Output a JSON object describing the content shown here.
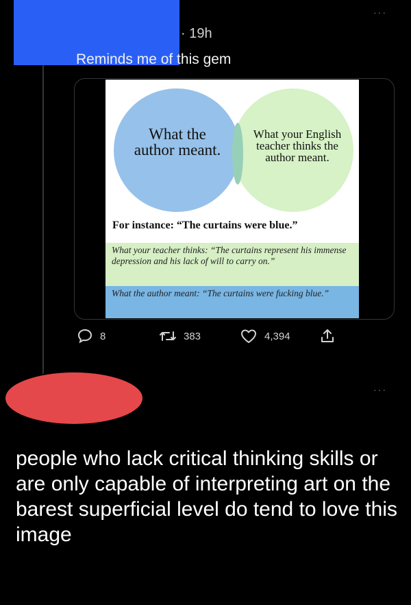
{
  "tweet": {
    "time": "· 19h",
    "text": "Reminds me of this gem",
    "more_label": "···",
    "image": {
      "left_circle": "What the author meant.",
      "right_circle": "What your English teacher thinks the author meant.",
      "instance": "For instance: “The curtains were blue.”",
      "teacher_box": "What your teacher thinks: “The curtains represent his immense depression and his lack of will to carry on.”",
      "author_box": "What the author meant: “The curtains were fucking blue.”"
    },
    "actions": {
      "replies": "8",
      "retweets": "383",
      "likes": "4,394"
    }
  },
  "reply": {
    "more_label": "···",
    "text": "people who lack critical thinking skills or are only capable of interpreting art on the barest superficial level do tend to love this image"
  },
  "colors": {
    "redaction_top": "#2a5ff6",
    "redaction_reply": "#e5484a",
    "venn_left": "#78b0e4",
    "venn_right": "#cbeeb6"
  }
}
